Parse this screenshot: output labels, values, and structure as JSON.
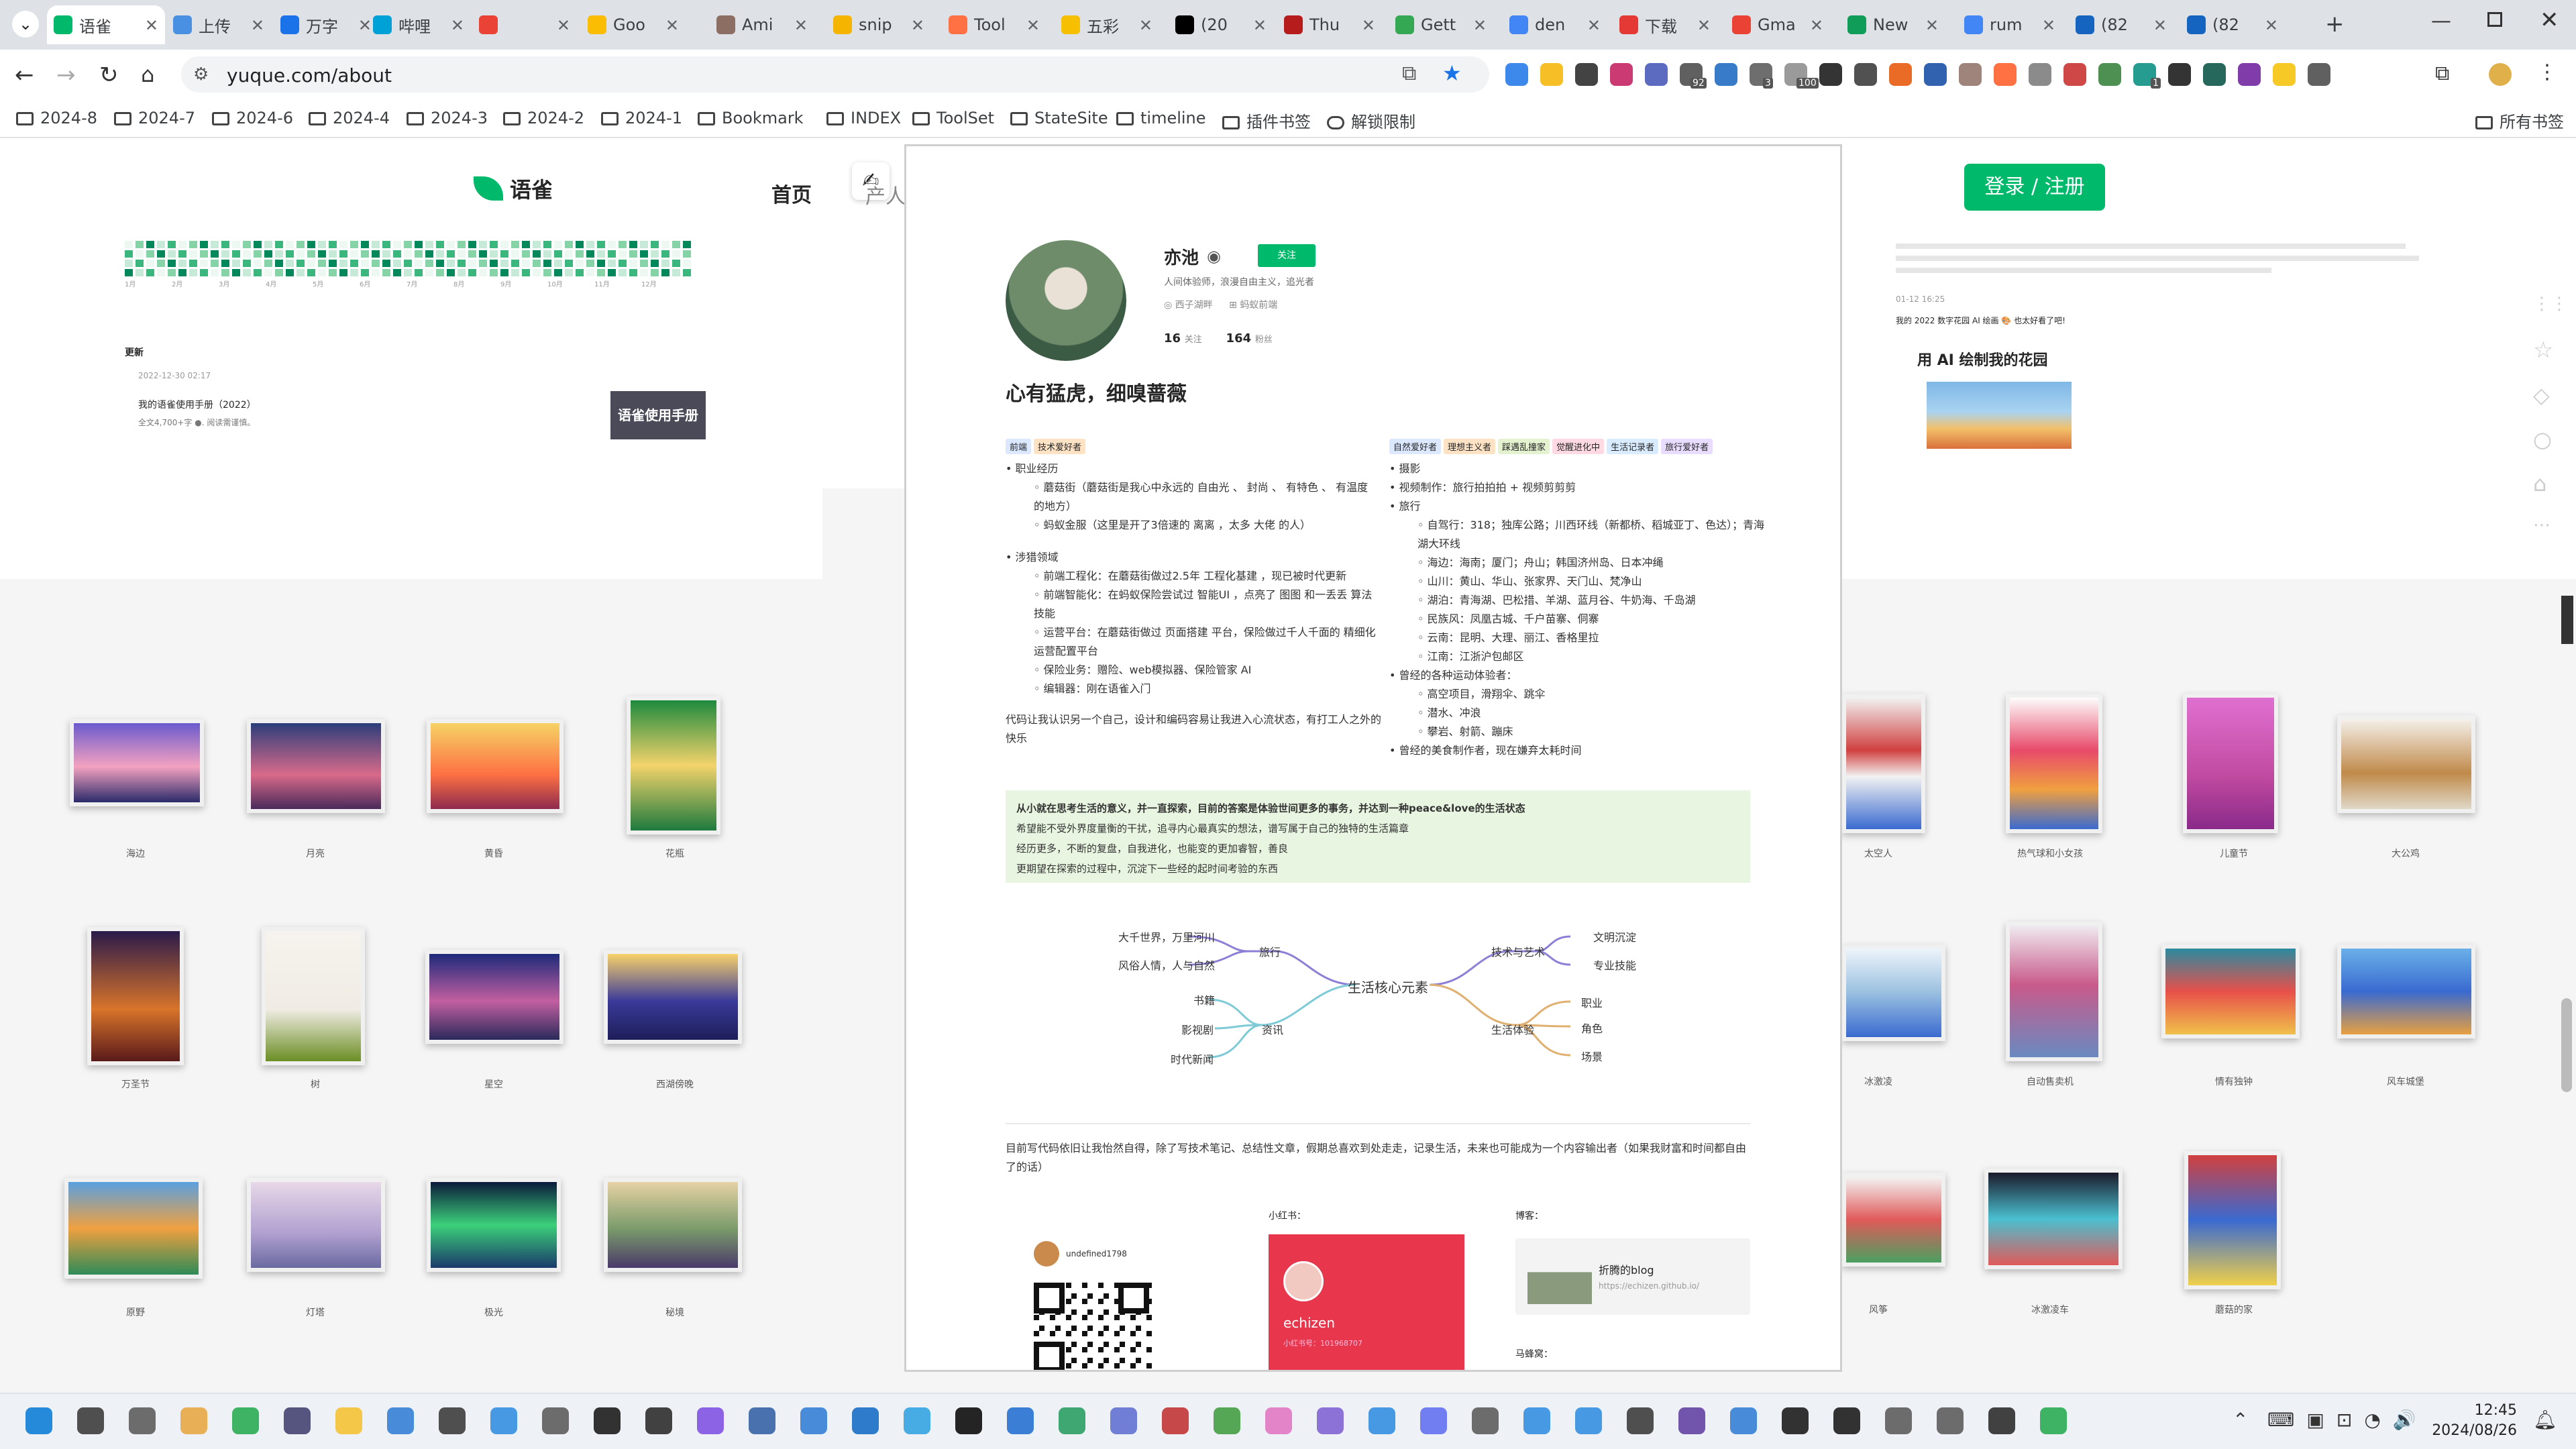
{
  "browser": {
    "tabs": [
      {
        "label": "语雀",
        "color": "#00b96b",
        "active": true
      },
      {
        "label": "上传",
        "color": "#4a90e2"
      },
      {
        "label": "万字",
        "color": "#1a73e8"
      },
      {
        "label": "哔哩",
        "color": "#00a1d6"
      },
      {
        "label": "",
        "color": "#ea4335"
      },
      {
        "label": "Goo",
        "color": "#fbbc04"
      },
      {
        "label": "Ami",
        "color": "#8d6e63"
      },
      {
        "label": "snip",
        "color": "#f4b400"
      },
      {
        "label": "Tool",
        "color": "#ff7043"
      },
      {
        "label": "五彩",
        "color": "#f6c000"
      },
      {
        "label": "(20",
        "color": "#000000"
      },
      {
        "label": "Thu",
        "color": "#b71c1c"
      },
      {
        "label": "Gett",
        "color": "#34a853"
      },
      {
        "label": "den",
        "color": "#4285f4"
      },
      {
        "label": "下载",
        "color": "#e53935"
      },
      {
        "label": "Gma",
        "color": "#ea4335"
      },
      {
        "label": "New",
        "color": "#0f9d58"
      },
      {
        "label": "rum",
        "color": "#4285f4"
      },
      {
        "label": "(82",
        "color": "#1565c0"
      },
      {
        "label": "(82",
        "color": "#1565c0"
      }
    ],
    "new_tab": "+",
    "url": "yuque.com/about",
    "bookmarks": [
      "2024-8",
      "2024-7",
      "2024-6",
      "2024-4",
      "2024-3",
      "2024-2",
      "2024-1",
      "Bookmark",
      "INDEX",
      "ToolSet",
      "StateSite",
      "timeline",
      "插件书签",
      "解锁限制"
    ],
    "all_bookmarks": "所有书签",
    "ext_badges": [
      "92",
      "3",
      "100",
      "1"
    ]
  },
  "yuque": {
    "logo": "语雀",
    "nav_home": "首页",
    "nav_partial": "产人",
    "login_button": "登录 / 注册",
    "heat_months": [
      "1月",
      "2月",
      "3月",
      "4月",
      "5月",
      "6月",
      "7月",
      "8月",
      "9月",
      "10月",
      "11月",
      "12月"
    ],
    "update_heading": "更新",
    "update_time": "2022-12-30 02:17",
    "doc_title": "我的语雀使用手册（2022）",
    "doc_meta": "全文4,700+字 ●. 阅读需谨慎。",
    "doc_thumb": "语雀使用手册",
    "right_time": "01-12 16:25",
    "right_title_line": "我的 2022 数字花园 AI 绘画 🎨 也太好看了吧!",
    "garden_title": "用 AI 绘制我的花园",
    "paintings_left": [
      "海边",
      "月亮",
      "黄昏",
      "花瓶",
      "万圣节",
      "树",
      "星空",
      "西湖傍晚",
      "原野",
      "灯塔",
      "极光",
      "秘境"
    ],
    "paintings_right": [
      "太空人",
      "热气球和小女孩",
      "儿童节",
      "大公鸡",
      "冰激凌",
      "自动售卖机",
      "情有独钟",
      "风车城堡",
      "风筝",
      "冰激凌车",
      "蘑菇的家"
    ]
  },
  "profile": {
    "name": "亦池",
    "follow_button": "关注",
    "bio": "人间体验师，浪漫自由主义，追光者",
    "location": "西子湖畔",
    "org": "蚂蚁前端",
    "following_count": "16",
    "following_label": "关注",
    "followers_count": "164",
    "followers_label": "粉丝",
    "headline": "心有猛虎，细嗅蔷薇",
    "left_tags": [
      "前端",
      "技术爱好者"
    ],
    "right_tags": [
      "自然爱好者",
      "理想主义者",
      "踩遇乱撞家",
      "觉醒进化中",
      "生活记录者",
      "旅行爱好者"
    ],
    "career_title": "职业经历",
    "career_items": [
      "蘑菇街（蘑菇街是我心中永远的 自由光 、 封尚 、 有特色 、 有温度 的地方）",
      "蚂蚁金服（这里是开了3倍速的 离离 ，太多 大佬 的人）"
    ],
    "domain_title": "涉猎领域",
    "domain_items": [
      "前端工程化：在蘑菇街做过2.5年 工程化基建 ，现已被时代更新",
      "前端智能化：在蚂蚁保险尝试过 智能UI ，点亮了 图图 和一丢丢 算法 技能",
      "运营平台：在蘑菇街做过 页面搭建 平台，保险做过千人千面的 精细化运营配置平台",
      "保险业务：赠险、web模拟器、保险管家 AI",
      "编辑器：刚在语雀入门"
    ],
    "left_para": "代码让我认识另一个自己，设计和编码容易让我进入心流状态，有打工人之外的快乐",
    "hobby_items": [
      "摄影",
      "视频制作：旅行拍拍拍 + 视频剪剪剪",
      "旅行"
    ],
    "travel_items": [
      "自驾行：318；独库公路；川西环线（新都桥、稻城亚丁、色达）；青海湖大环线",
      "海边：海南；厦门；舟山；韩国济州岛、日本冲绳",
      "山川：黄山、华山、张家界、天门山、梵净山",
      "湖泊：青海湖、巴松措、羊湖、蓝月谷、牛奶海、千岛湖",
      "民族风：凤凰古城、千户苗寨、侗寨",
      "云南：昆明、大理、丽江、香格里拉",
      "江南：江浙沪包邮区"
    ],
    "sport_title": "曾经的各种运动体验者：",
    "sport_items": [
      "高空项目，滑翔伞、跳伞",
      "潜水、冲浪",
      "攀岩、射箭、蹦床"
    ],
    "food_item": "曾经的美食制作者，现在嫌弃太耗时间",
    "quote_lines": [
      "从小就在思考生活的意义，并一直探索，目前的答案是体验世间更多的事务，并达到一种peace&love的生活状态",
      "希望能不受外界度量衡的干扰，追寻内心最真实的想法，谱写属于自己的独特的生活篇章",
      "经历更多，不断的复盘，自我进化，也能变的更加睿智，善良",
      "更期望在探索的过程中，沉淀下一些经的起时间考验的东西"
    ],
    "mindmap": {
      "center": "生活核心元素",
      "travel": "旅行",
      "travel_a": "大千世界，万里河川",
      "travel_b": "风俗人情，人与自然",
      "info": "资讯",
      "info_a": "书籍",
      "info_b": "影视剧",
      "info_c": "时代新闻",
      "tech": "技术与艺术",
      "tech_a": "文明沉淀",
      "tech_b": "专业技能",
      "life": "生活体验",
      "life_a": "职业",
      "life_b": "角色",
      "life_c": "场景"
    },
    "bottom_para": "目前写代码依旧让我怡然自得，除了写技术笔记、总结性文章，假期总喜欢到处走走，记录生活，未来也可能成为一个内容输出者（如果我财富和时间都自由了的话）",
    "wechat_name": "undefined1798",
    "xhs_label": "小红书：",
    "xhs_name": "echizen",
    "xhs_id": "小红书号：101968707",
    "blog_label": "博客：",
    "blog_title": "折腾的blog",
    "blog_url": "https://echizen.github.io/",
    "mafengwo_label": "马蜂窝："
  },
  "system": {
    "time": "12:45",
    "date": "2024/08/26"
  }
}
